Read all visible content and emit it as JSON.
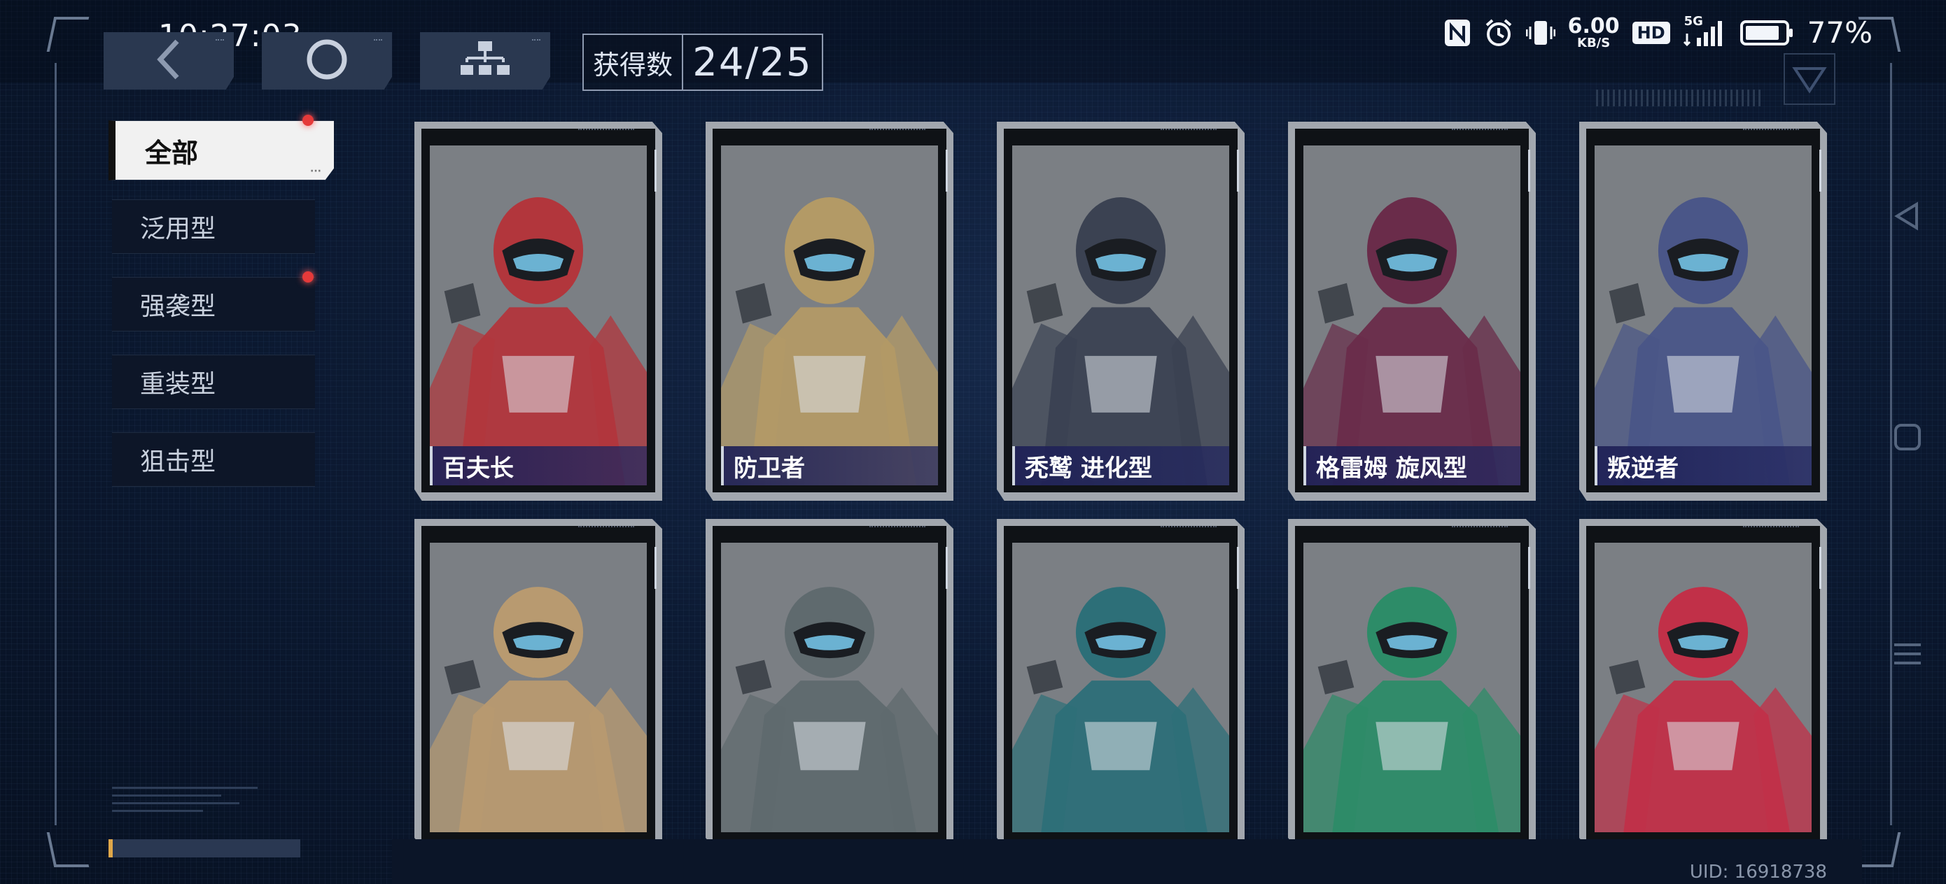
{
  "status_bar": {
    "time": "10:27:03",
    "net_speed_value": "6.00",
    "net_speed_unit": "KB/S",
    "hd": "HD",
    "network": "5G",
    "battery": "77%"
  },
  "top_nav": {
    "back_icon": "chevron-left-icon",
    "circle_icon": "ring-icon",
    "tree_icon": "hierarchy-icon",
    "collect_label": "获得数",
    "collect_value": "24/25"
  },
  "sidebar": {
    "tabs": [
      {
        "label": "全部",
        "active": true,
        "red_dot": true
      },
      {
        "label": "泛用型",
        "active": false,
        "red_dot": false
      },
      {
        "label": "强袭型",
        "active": false,
        "red_dot": true
      },
      {
        "label": "重装型",
        "active": false,
        "red_dot": false
      },
      {
        "label": "狙击型",
        "active": false,
        "red_dot": false
      }
    ]
  },
  "cards": [
    {
      "name": "百夫长",
      "color": "#b2363c"
    },
    {
      "name": "防卫者",
      "color": "#b39a66"
    },
    {
      "name": "秃鹫 进化型",
      "color": "#3b4252"
    },
    {
      "name": "格雷姆 旋风型",
      "color": "#6a2c4a"
    },
    {
      "name": "叛逆者",
      "color": "#4a5688"
    },
    {
      "name": "",
      "color": "#b89a70"
    },
    {
      "name": "",
      "color": "#5f6a6e"
    },
    {
      "name": "",
      "color": "#2d6f78"
    },
    {
      "name": "",
      "color": "#2d8c68"
    },
    {
      "name": "",
      "color": "#c13048"
    }
  ],
  "footer": {
    "uid": "UID: 16918738"
  },
  "colors": {
    "background": "#0c1a33",
    "card_frame": "#a2a7ae",
    "name_bar": "#1e2056",
    "red_dot": "#e53a3a"
  }
}
